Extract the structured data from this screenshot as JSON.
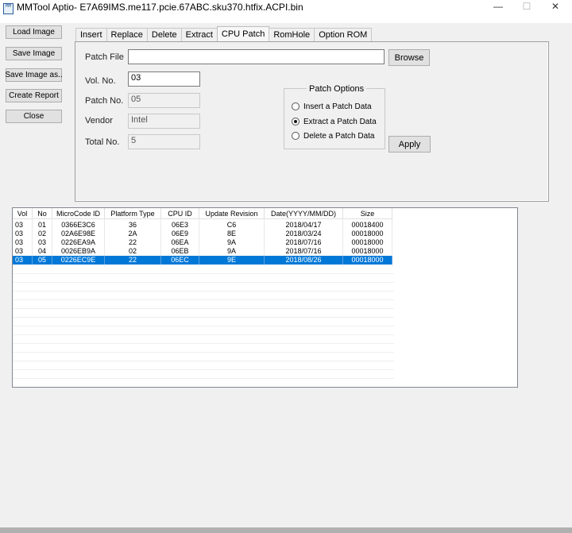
{
  "window": {
    "title": "MMTool Aptio- E7A69IMS.me117.pcie.67ABC.sku370.htfix.ACPI.bin",
    "icon_text": "MM",
    "minimize": "—",
    "maximize": "☐",
    "close": "✕"
  },
  "left_buttons": {
    "load": "Load Image",
    "save": "Save Image",
    "save_as": "Save Image as..",
    "report": "Create Report",
    "close": "Close"
  },
  "tabs": [
    "Insert",
    "Replace",
    "Delete",
    "Extract",
    "CPU Patch",
    "RomHole",
    "Option ROM"
  ],
  "active_tab": "CPU Patch",
  "form": {
    "patch_file_label": "Patch File",
    "patch_file_value": "",
    "browse": "Browse",
    "vol_no_label": "Vol. No.",
    "vol_no_value": "03",
    "patch_no_label": "Patch No.",
    "patch_no_value": "05",
    "vendor_label": "Vendor",
    "vendor_value": "Intel",
    "total_no_label": "Total No.",
    "total_no_value": "5",
    "apply": "Apply"
  },
  "patch_options": {
    "title": "Patch Options",
    "options": [
      "Insert a Patch Data",
      "Extract a Patch Data",
      "Delete a Patch Data"
    ],
    "selected": "Extract a Patch Data"
  },
  "table": {
    "columns": [
      "Vol",
      "No",
      "MicroCode ID",
      "Platform Type",
      "CPU ID",
      "Update Revision",
      "Date(YYYY/MM/DD)",
      "Size"
    ],
    "rows": [
      [
        "03",
        "01",
        "0366E3C6",
        "36",
        "06E3",
        "C6",
        "2018/04/17",
        "00018400"
      ],
      [
        "03",
        "02",
        "02A6E98E",
        "2A",
        "06E9",
        "8E",
        "2018/03/24",
        "00018000"
      ],
      [
        "03",
        "03",
        "0226EA9A",
        "22",
        "06EA",
        "9A",
        "2018/07/16",
        "00018000"
      ],
      [
        "03",
        "04",
        "0026EB9A",
        "02",
        "06EB",
        "9A",
        "2018/07/16",
        "00018000"
      ],
      [
        "03",
        "05",
        "0226EC9E",
        "22",
        "06EC",
        "9E",
        "2018/08/26",
        "00018000"
      ]
    ],
    "selected_row": 4,
    "selection_color": "#0078d7"
  }
}
